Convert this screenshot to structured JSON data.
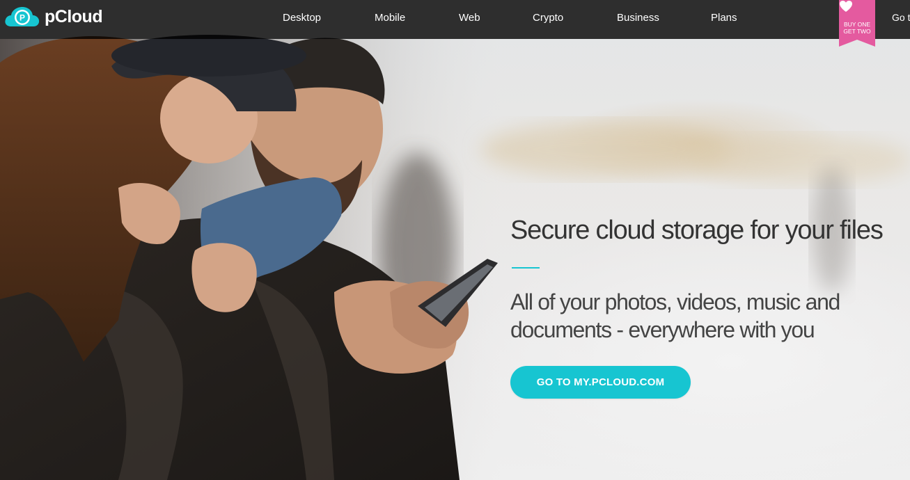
{
  "brand": {
    "name": "pCloud",
    "logo_icon": "pcloud-logo-icon",
    "logo_letter": "P"
  },
  "nav": {
    "items": [
      {
        "label": "Desktop"
      },
      {
        "label": "Mobile"
      },
      {
        "label": "Web"
      },
      {
        "label": "Crypto"
      },
      {
        "label": "Business"
      },
      {
        "label": "Plans"
      }
    ],
    "goto_label": "Go t"
  },
  "promo": {
    "icon": "heart-icon",
    "line1": "BUY ONE",
    "line2": "GET TWO"
  },
  "hero": {
    "headline": "Secure cloud storage for your files",
    "subline_1": "All of your photos, videos, music and",
    "subline_2": "documents - everywhere with you",
    "cta_label": "GO TO MY.PCLOUD.COM"
  },
  "colors": {
    "accent": "#17c5d1",
    "promo_pink": "#e45a9f",
    "nav_bg": "#1a1a1a",
    "headline_text": "#333333"
  }
}
